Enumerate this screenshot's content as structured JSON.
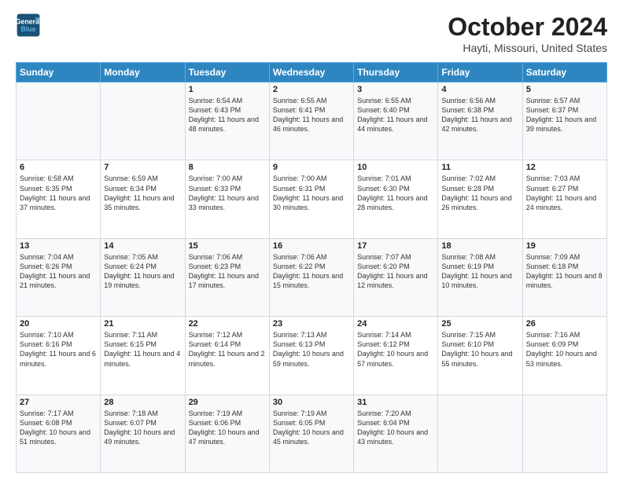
{
  "header": {
    "logo_line1": "General",
    "logo_line2": "Blue",
    "month": "October 2024",
    "location": "Hayti, Missouri, United States"
  },
  "days_of_week": [
    "Sunday",
    "Monday",
    "Tuesday",
    "Wednesday",
    "Thursday",
    "Friday",
    "Saturday"
  ],
  "weeks": [
    [
      {
        "day": "",
        "info": ""
      },
      {
        "day": "",
        "info": ""
      },
      {
        "day": "1",
        "info": "Sunrise: 6:54 AM\nSunset: 6:43 PM\nDaylight: 11 hours and 48 minutes."
      },
      {
        "day": "2",
        "info": "Sunrise: 6:55 AM\nSunset: 6:41 PM\nDaylight: 11 hours and 46 minutes."
      },
      {
        "day": "3",
        "info": "Sunrise: 6:55 AM\nSunset: 6:40 PM\nDaylight: 11 hours and 44 minutes."
      },
      {
        "day": "4",
        "info": "Sunrise: 6:56 AM\nSunset: 6:38 PM\nDaylight: 11 hours and 42 minutes."
      },
      {
        "day": "5",
        "info": "Sunrise: 6:57 AM\nSunset: 6:37 PM\nDaylight: 11 hours and 39 minutes."
      }
    ],
    [
      {
        "day": "6",
        "info": "Sunrise: 6:58 AM\nSunset: 6:35 PM\nDaylight: 11 hours and 37 minutes."
      },
      {
        "day": "7",
        "info": "Sunrise: 6:59 AM\nSunset: 6:34 PM\nDaylight: 11 hours and 35 minutes."
      },
      {
        "day": "8",
        "info": "Sunrise: 7:00 AM\nSunset: 6:33 PM\nDaylight: 11 hours and 33 minutes."
      },
      {
        "day": "9",
        "info": "Sunrise: 7:00 AM\nSunset: 6:31 PM\nDaylight: 11 hours and 30 minutes."
      },
      {
        "day": "10",
        "info": "Sunrise: 7:01 AM\nSunset: 6:30 PM\nDaylight: 11 hours and 28 minutes."
      },
      {
        "day": "11",
        "info": "Sunrise: 7:02 AM\nSunset: 6:28 PM\nDaylight: 11 hours and 26 minutes."
      },
      {
        "day": "12",
        "info": "Sunrise: 7:03 AM\nSunset: 6:27 PM\nDaylight: 11 hours and 24 minutes."
      }
    ],
    [
      {
        "day": "13",
        "info": "Sunrise: 7:04 AM\nSunset: 6:26 PM\nDaylight: 11 hours and 21 minutes."
      },
      {
        "day": "14",
        "info": "Sunrise: 7:05 AM\nSunset: 6:24 PM\nDaylight: 11 hours and 19 minutes."
      },
      {
        "day": "15",
        "info": "Sunrise: 7:06 AM\nSunset: 6:23 PM\nDaylight: 11 hours and 17 minutes."
      },
      {
        "day": "16",
        "info": "Sunrise: 7:06 AM\nSunset: 6:22 PM\nDaylight: 11 hours and 15 minutes."
      },
      {
        "day": "17",
        "info": "Sunrise: 7:07 AM\nSunset: 6:20 PM\nDaylight: 11 hours and 12 minutes."
      },
      {
        "day": "18",
        "info": "Sunrise: 7:08 AM\nSunset: 6:19 PM\nDaylight: 11 hours and 10 minutes."
      },
      {
        "day": "19",
        "info": "Sunrise: 7:09 AM\nSunset: 6:18 PM\nDaylight: 11 hours and 8 minutes."
      }
    ],
    [
      {
        "day": "20",
        "info": "Sunrise: 7:10 AM\nSunset: 6:16 PM\nDaylight: 11 hours and 6 minutes."
      },
      {
        "day": "21",
        "info": "Sunrise: 7:11 AM\nSunset: 6:15 PM\nDaylight: 11 hours and 4 minutes."
      },
      {
        "day": "22",
        "info": "Sunrise: 7:12 AM\nSunset: 6:14 PM\nDaylight: 11 hours and 2 minutes."
      },
      {
        "day": "23",
        "info": "Sunrise: 7:13 AM\nSunset: 6:13 PM\nDaylight: 10 hours and 59 minutes."
      },
      {
        "day": "24",
        "info": "Sunrise: 7:14 AM\nSunset: 6:12 PM\nDaylight: 10 hours and 57 minutes."
      },
      {
        "day": "25",
        "info": "Sunrise: 7:15 AM\nSunset: 6:10 PM\nDaylight: 10 hours and 55 minutes."
      },
      {
        "day": "26",
        "info": "Sunrise: 7:16 AM\nSunset: 6:09 PM\nDaylight: 10 hours and 53 minutes."
      }
    ],
    [
      {
        "day": "27",
        "info": "Sunrise: 7:17 AM\nSunset: 6:08 PM\nDaylight: 10 hours and 51 minutes."
      },
      {
        "day": "28",
        "info": "Sunrise: 7:18 AM\nSunset: 6:07 PM\nDaylight: 10 hours and 49 minutes."
      },
      {
        "day": "29",
        "info": "Sunrise: 7:19 AM\nSunset: 6:06 PM\nDaylight: 10 hours and 47 minutes."
      },
      {
        "day": "30",
        "info": "Sunrise: 7:19 AM\nSunset: 6:05 PM\nDaylight: 10 hours and 45 minutes."
      },
      {
        "day": "31",
        "info": "Sunrise: 7:20 AM\nSunset: 6:04 PM\nDaylight: 10 hours and 43 minutes."
      },
      {
        "day": "",
        "info": ""
      },
      {
        "day": "",
        "info": ""
      }
    ]
  ]
}
